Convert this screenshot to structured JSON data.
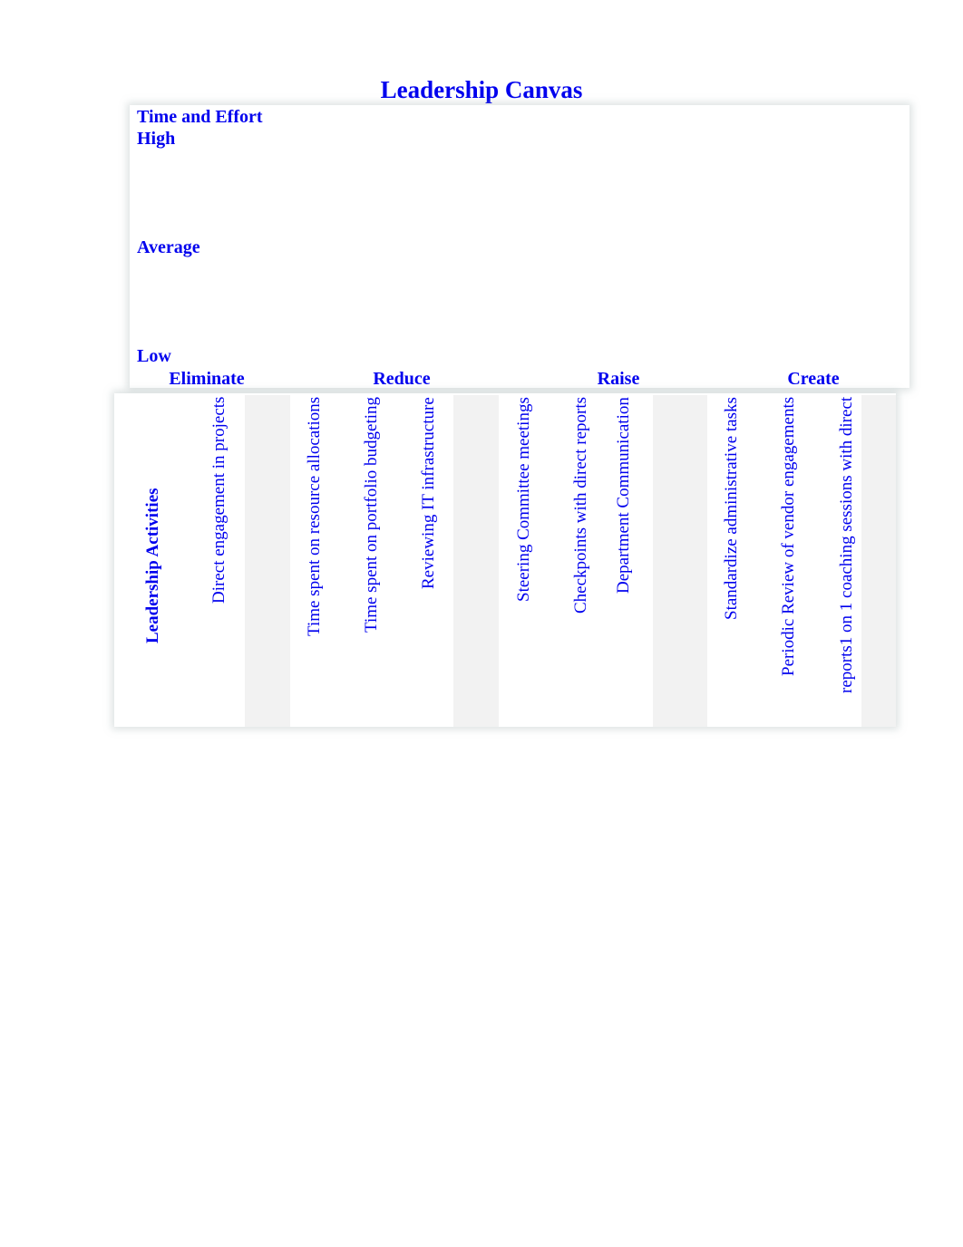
{
  "title": "Leadership Canvas",
  "axis": {
    "heading": "Time and Effort",
    "high": "High",
    "average": "Average",
    "low": "Low"
  },
  "categories": [
    "Eliminate",
    "Reduce",
    "Raise",
    "Create"
  ],
  "row_label": "Leadership Activities",
  "activities": [
    {
      "category": "Eliminate",
      "text": "Direct engagement in projects"
    },
    {
      "category": "Reduce",
      "text": "Time spent on resource allocations"
    },
    {
      "category": "Reduce",
      "text": "Time spent on portfolio budgeting"
    },
    {
      "category": "Reduce",
      "text": "Reviewing IT infrastructure"
    },
    {
      "category": "Raise",
      "text": "Steering Committee meetings"
    },
    {
      "category": "Raise",
      "text": "Checkpoints with direct reports"
    },
    {
      "category": "Raise",
      "text": "Department Communication"
    },
    {
      "category": "Create",
      "text": "Standardize administrative tasks"
    },
    {
      "category": "Create",
      "text": "Periodic Review of vendor engagements"
    },
    {
      "category": "Create",
      "text": "reports1 on 1 coaching sessions with direct"
    }
  ],
  "colors": {
    "text": "#0000ee",
    "frame": "#e3eaea"
  }
}
